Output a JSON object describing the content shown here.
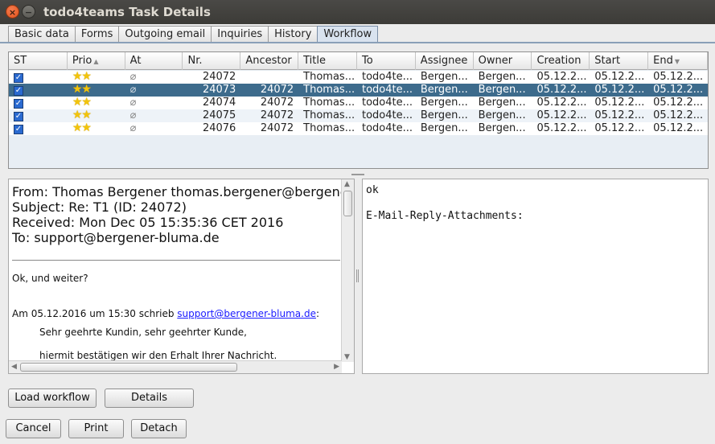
{
  "window": {
    "title": "todo4teams Task Details",
    "close_glyph": "×",
    "min_glyph": "−"
  },
  "tabs": [
    {
      "label": "Basic data"
    },
    {
      "label": "Forms"
    },
    {
      "label": "Outgoing email"
    },
    {
      "label": "Inquiries"
    },
    {
      "label": "History"
    },
    {
      "label": "Workflow"
    }
  ],
  "active_tab": "Workflow",
  "table": {
    "columns": [
      "ST",
      "Prio",
      "At",
      "Nr.",
      "Ancestor",
      "Title",
      "To",
      "Assignee",
      "Owner",
      "Creation",
      "Start",
      "End"
    ],
    "sort_glyph": "▲",
    "rows": [
      {
        "nr": "24072",
        "ancestor": "",
        "title": "Thomas...",
        "to": "todo4te...",
        "assignee": "Bergen...",
        "owner": "Bergen...",
        "creation": "05.12.2...",
        "start": "05.12.2...",
        "end": "05.12.2..."
      },
      {
        "nr": "24073",
        "ancestor": "24072",
        "title": "Thomas...",
        "to": "todo4te...",
        "assignee": "Bergen...",
        "owner": "Bergen...",
        "creation": "05.12.2...",
        "start": "05.12.2...",
        "end": "05.12.2..."
      },
      {
        "nr": "24074",
        "ancestor": "24072",
        "title": "Thomas...",
        "to": "todo4te...",
        "assignee": "Bergen...",
        "owner": "Bergen...",
        "creation": "05.12.2...",
        "start": "05.12.2...",
        "end": "05.12.2..."
      },
      {
        "nr": "24075",
        "ancestor": "24072",
        "title": "Thomas...",
        "to": "todo4te...",
        "assignee": "Bergen...",
        "owner": "Bergen...",
        "creation": "05.12.2...",
        "start": "05.12.2...",
        "end": "05.12.2..."
      },
      {
        "nr": "24076",
        "ancestor": "24072",
        "title": "Thomas...",
        "to": "todo4te...",
        "assignee": "Bergen...",
        "owner": "Bergen...",
        "creation": "05.12.2...",
        "start": "05.12.2...",
        "end": "05.12.2..."
      }
    ],
    "selected_row_index": 1,
    "check_glyph": "✓",
    "stars_glyph": "★★",
    "attachment_glyph": "⌀"
  },
  "mail": {
    "from": "From: Thomas Bergener  thomas.bergener@bergener-bluma.de",
    "subject": "Subject: Re: T1 (ID: 24072)",
    "received": "Received: Mon Dec 05 15:35:36 CET 2016",
    "to": "To: support@bergener-bluma.de",
    "body_line1": "Ok, und weiter?",
    "quote_prefix": "Am 05.12.2016 um 15:30 schrieb ",
    "quote_link": "support@bergener-bluma.de",
    "quote_suffix": ":",
    "quote_line1": "Sehr geehrte Kundin, sehr geehrter Kunde,",
    "quote_line2": "hiermit bestätigen wir den Erhalt Ihrer Nachricht."
  },
  "reply": {
    "line1": "ok",
    "line2": "E-Mail-Reply-Attachments:"
  },
  "buttons": {
    "load_workflow": "Load workflow",
    "details": "Details",
    "cancel": "Cancel",
    "print": "Print",
    "detach": "Detach"
  }
}
